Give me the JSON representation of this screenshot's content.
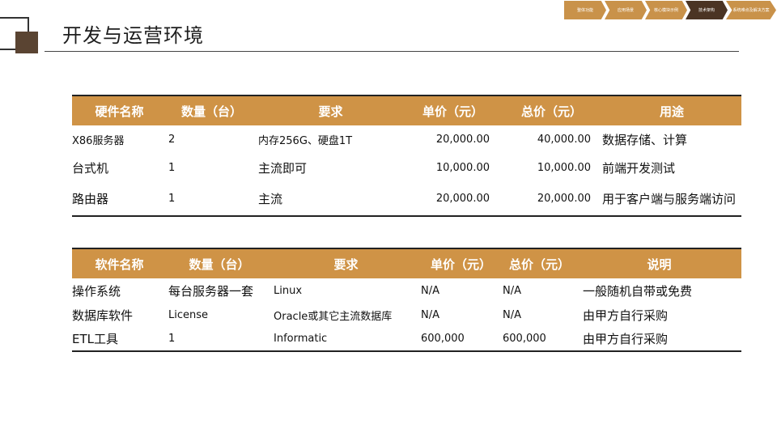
{
  "page": {
    "title": "开发与运营环境"
  },
  "nav": {
    "steps": [
      "整体功能",
      "应用场景",
      "核心模块示例",
      "技术架构",
      "系统难点及解决方案"
    ],
    "active_index": 3
  },
  "hardware_table": {
    "headers": [
      "硬件名称",
      "数量（台）",
      "要求",
      "单价（元）",
      "总价（元）",
      "用途"
    ],
    "rows": [
      [
        "X86服务器",
        "2",
        "内存256G、硬盘1T",
        "20,000.00",
        "40,000.00",
        "数据存储、计算"
      ],
      [
        "台式机",
        "1",
        "主流即可",
        "10,000.00",
        "10,000.00",
        "前端开发测试"
      ],
      [
        "路由器",
        "1",
        "主流",
        "20,000.00",
        "20,000.00",
        "用于客户端与服务端访问"
      ]
    ]
  },
  "software_table": {
    "headers": [
      "软件名称",
      "数量（台）",
      "要求",
      "单价（元）",
      "总价（元）",
      "说明"
    ],
    "rows": [
      [
        "操作系统",
        "每台服务器一套",
        "Linux",
        "N/A",
        "N/A",
        "一般随机自带或免费"
      ],
      [
        "数据库软件",
        "License",
        "Oracle或其它主流数据库",
        "N/A",
        "N/A",
        "由甲方自行采购"
      ],
      [
        "ETL工具",
        "1",
        "Informatic",
        "600,000",
        "600,000",
        "由甲方自行采购"
      ]
    ]
  },
  "colors": {
    "header_bg": "#cf9346",
    "nav_bg": "#c9924a",
    "nav_active": "#4b3424",
    "corner": "#5a4432"
  }
}
